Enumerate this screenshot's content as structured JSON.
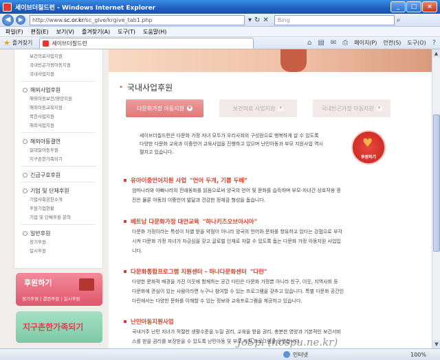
{
  "window": {
    "title": "세이브더칠드런 - Windows Internet Explorer",
    "controls": [
      "_",
      "□",
      "×"
    ]
  },
  "addressbar": {
    "url_prefix": "http://www.",
    "url_host": "sc.or.kr",
    "url_path": "/sc_give/krgive_tab1.php",
    "search_placeholder": "Bing"
  },
  "menu": [
    "파일(F)",
    "편집(E)",
    "보기(V)",
    "즐겨찾기(A)",
    "도구(T)",
    "도움말(H)"
  ],
  "favbar": {
    "favorites_label": "즐겨찾기",
    "tab_title": "세이브더칠드런",
    "commands": [
      "페이지(P)",
      "안전(S)",
      "도구(O)"
    ]
  },
  "sidebar": {
    "top_subs": [
      "보건의료사업지원",
      "국내빈곤가정아동지원",
      "국내사업지원"
    ],
    "groups": [
      {
        "label": "해외사업후원",
        "subs": [
          "해외아동보건/영양지원",
          "해외아동교육지원",
          "북한사업지원",
          "해외사업지원"
        ]
      },
      {
        "label": "해외아동결연",
        "subs": [
          "일대일아동후원",
          "지구촌한가족되기"
        ]
      },
      {
        "label": "긴급구호후원",
        "subs": []
      },
      {
        "label": "기업 및 단체후원",
        "subs": [
          "기업사회공헌소개",
          "후원기업현황",
          "기업 및 단체후원 문의"
        ]
      },
      {
        "label": "일반후원",
        "subs": [
          "정기후원",
          "일시후원"
        ]
      }
    ],
    "donate_title": "후원하기",
    "donate_links": "정기후원 | 결연후원 | 일시후원",
    "family_text": "지구촌한가족되기"
  },
  "main": {
    "title": "국내사업후원",
    "tabs": [
      {
        "label": "다문화가정 아동지원",
        "active": true
      },
      {
        "label": "보건의료 사업지원",
        "active": false
      },
      {
        "label": "국내빈곤가정 아동지원",
        "active": false
      }
    ],
    "intro_lines": [
      "세이브더칠드런은 다문화 가정 자녀 모두가 우리사회의 구성원으로 행복하게 살 수 있도록",
      "다양한 다문화 교육과 이중언어 교육사업을 진행하고 있으며 난민아동과 부모 지원사업 역시",
      "펼치고 있습니다."
    ],
    "donate_button": "후원하기",
    "sections": [
      {
        "title": "유아이중언어지원 사업",
        "quote": "\"언어 두개, 기쁨 두배\"",
        "lines": [
          "엄마나라와 아빠나라의 전래동화를 읽음으로써 양국의 언어 및 문화를 습득하며 부모-자녀간 상호작용 증",
          "진은 물론 아동의 이중언어 발달과 건강한 정체감 형성을 돕습니다."
        ]
      },
      {
        "title": "베트남 다문화가정 대안교육",
        "quote": "\"하나키즈오브아시아\"",
        "lines": [
          "다문화 가정이라는 특성이 차별 받을 약점이 아니라 양국의 언어와 문화를 향유하고 있다는 강점으로 부각",
          "시켜 다문화 가정 자녀가 자긍심을 갖고 글로벌 인재로 자랄 수 있도록 돕는 다문화 가정 아동지원 사업입",
          "니다."
        ]
      },
      {
        "title": "다문화통합프로그램 지원센터 - 하나다문화센터",
        "quote": "\"다린\"",
        "lines": [
          "다양한 문화적 배경을 가진 이웃에 함께하는 공간 다린은 다문화 가정뿐 아니라 친구, 이웃, 지역사회 등",
          "다문화에 관심이 있는 사람이라면 누구나 참여할 수 있는 프로그램을 갖추고 있습니다. 특별 다문화 공간인",
          "다린에서는 다양한 문화를 이해할 수 있는 정보와 교육프로그램을 제공하고 있습니다."
        ]
      },
      {
        "title": "난민아동지원사업",
        "quote": "",
        "lines": [
          "국내거주 난민 자녀가 적절한 생활수준을 누릴 권리, 교육을 받을 권리, 충분한 영양과 기본적인 보건서비",
          "스를 받을 권리를 보장받을 수 있도록 난민아동 및 부모 지원 프로그램을 운영합니다."
        ]
      }
    ]
  },
  "statusbar": {
    "zone": "인터넷",
    "zoom": "100%"
  },
  "watermark": "JoSpi (hospu.ne.kr)"
}
